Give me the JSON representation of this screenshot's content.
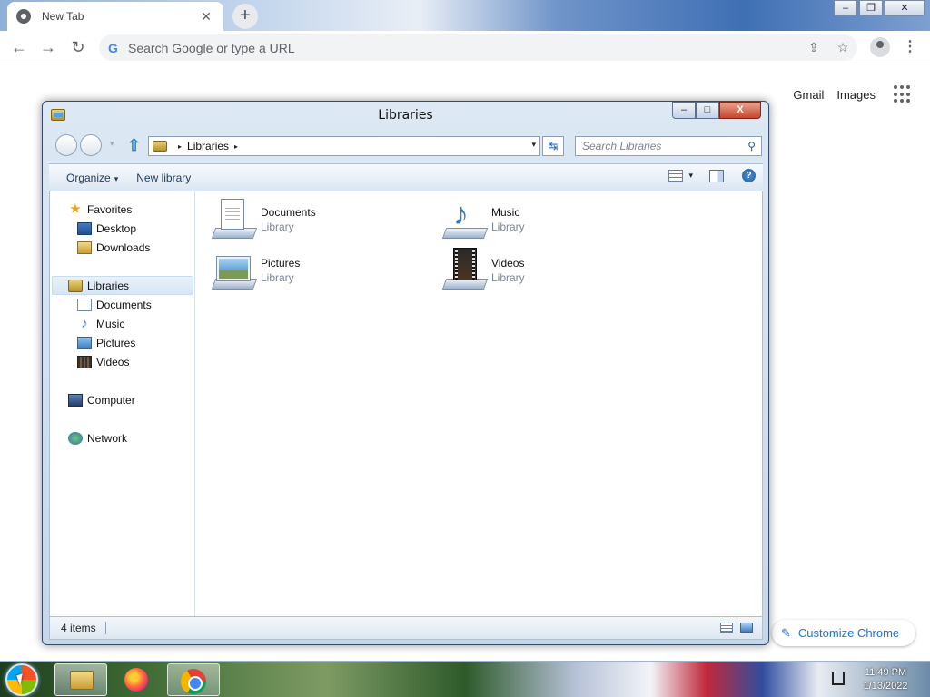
{
  "browser": {
    "tab_title": "New Tab",
    "tab_close": "✕",
    "new_tab": "+",
    "window_controls": {
      "minimize": "‒",
      "restore": "❐",
      "close": "✕"
    },
    "nav": {
      "back": "←",
      "forward": "→",
      "reload": "↻"
    },
    "omnibox": {
      "g": "G",
      "placeholder": "Search Google or type a URL"
    },
    "kebab": "⋮",
    "share_icon": "⇪",
    "star_icon": "☆"
  },
  "ntp": {
    "gmail": "Gmail",
    "images": "Images",
    "customize": "Customize Chrome",
    "customize_icon": "✎"
  },
  "explorer": {
    "title": "Libraries",
    "controls": {
      "minimize": "–",
      "maximize": "□",
      "close": "X"
    },
    "address": {
      "crumb": "Libraries",
      "sep": "▸",
      "dropdown": "▾"
    },
    "refresh": "↹",
    "search_placeholder": "Search Libraries",
    "search_icon": "⚲",
    "up": "⇧",
    "recent": "▾",
    "commands": {
      "organize": "Organize",
      "new_library": "New library",
      "caret": "▾",
      "view_dd": "▾",
      "help": "?"
    },
    "nav_pane": {
      "favorites": "Favorites",
      "desktop": "Desktop",
      "downloads": "Downloads",
      "libraries": "Libraries",
      "documents": "Documents",
      "music": "Music",
      "pictures": "Pictures",
      "videos": "Videos",
      "computer": "Computer",
      "network": "Network",
      "star": "★",
      "note": "♪"
    },
    "libraries": [
      {
        "name": "Documents",
        "type": "Library"
      },
      {
        "name": "Music",
        "type": "Library"
      },
      {
        "name": "Pictures",
        "type": "Library"
      },
      {
        "name": "Videos",
        "type": "Library"
      }
    ],
    "music_note": "♪",
    "status": {
      "count": "4 items"
    }
  },
  "taskbar": {
    "time": "11:49 PM",
    "date": "1/13/2022"
  }
}
